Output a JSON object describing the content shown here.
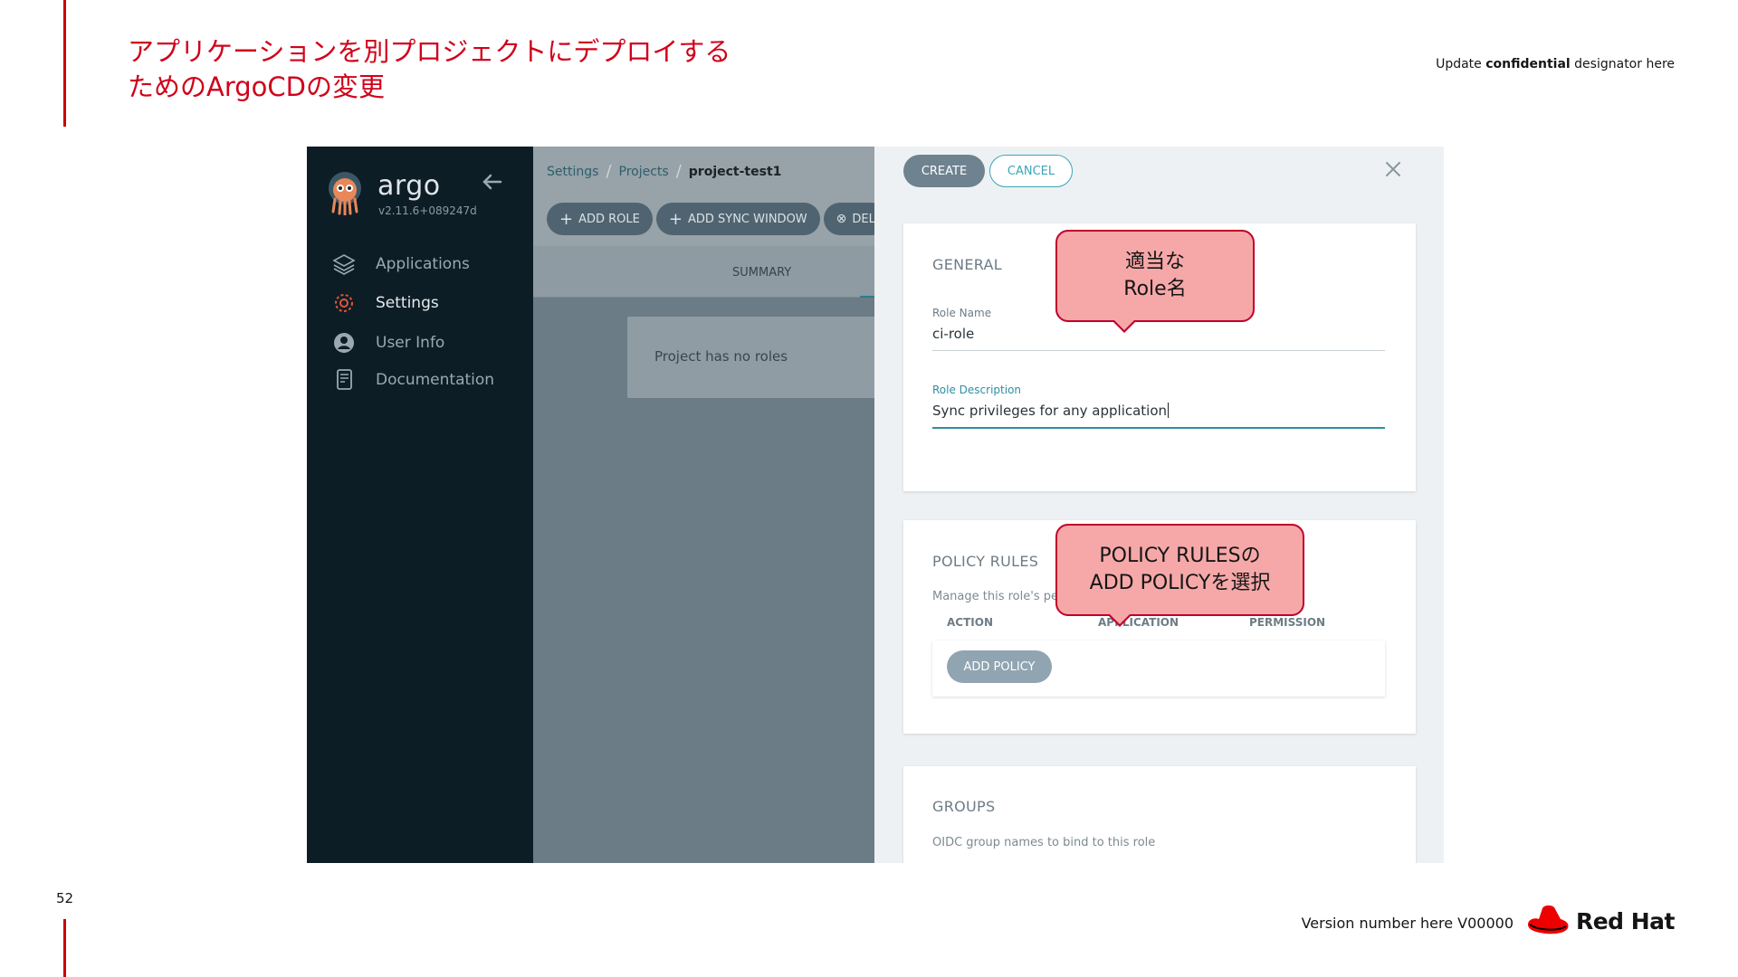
{
  "slide": {
    "title_line1": "アプリケーションを別プロジェクトにデプロイする",
    "title_line2": "ためのArgoCDの変更",
    "confidential_prefix": "Update ",
    "confidential_bold": "confidential",
    "confidential_suffix": " designator here",
    "page_number": "52",
    "version": "Version number here V00000",
    "brand": "Red Hat",
    "accent_color": "#cc0000"
  },
  "argo": {
    "logo_text": "argo",
    "version": "v2.11.6+089247d",
    "nav": [
      {
        "label": "Applications",
        "icon": "layers-icon"
      },
      {
        "label": "Settings",
        "icon": "gear-icon"
      },
      {
        "label": "User Info",
        "icon": "user-circle-icon"
      },
      {
        "label": "Documentation",
        "icon": "book-icon"
      }
    ],
    "breadcrumb": {
      "settings": "Settings",
      "projects": "Projects",
      "current": "project-test1"
    },
    "toolbar": {
      "add_role": "ADD ROLE",
      "add_sync_window": "ADD SYNC WINDOW",
      "delete": "DEL"
    },
    "tab_summary": "SUMMARY",
    "empty_roles": "Project has no roles"
  },
  "panel": {
    "create": "CREATE",
    "cancel": "CANCEL",
    "general_title": "GENERAL",
    "role_name_label": "Role Name",
    "role_name_value": "ci-role",
    "role_desc_label": "Role Description",
    "role_desc_value": "Sync privileges for any application",
    "policy_title": "POLICY RULES",
    "policy_desc": "Manage this role's per",
    "col_action": "ACTION",
    "col_application": "APPLICATION",
    "col_permission": "PERMISSION",
    "add_policy": "ADD POLICY",
    "groups_title": "GROUPS",
    "groups_desc": "OIDC group names to bind to this role"
  },
  "callouts": {
    "role_name": "適当な\nRole名",
    "policy": "POLICY RULESの\nADD POLICYを選択"
  }
}
